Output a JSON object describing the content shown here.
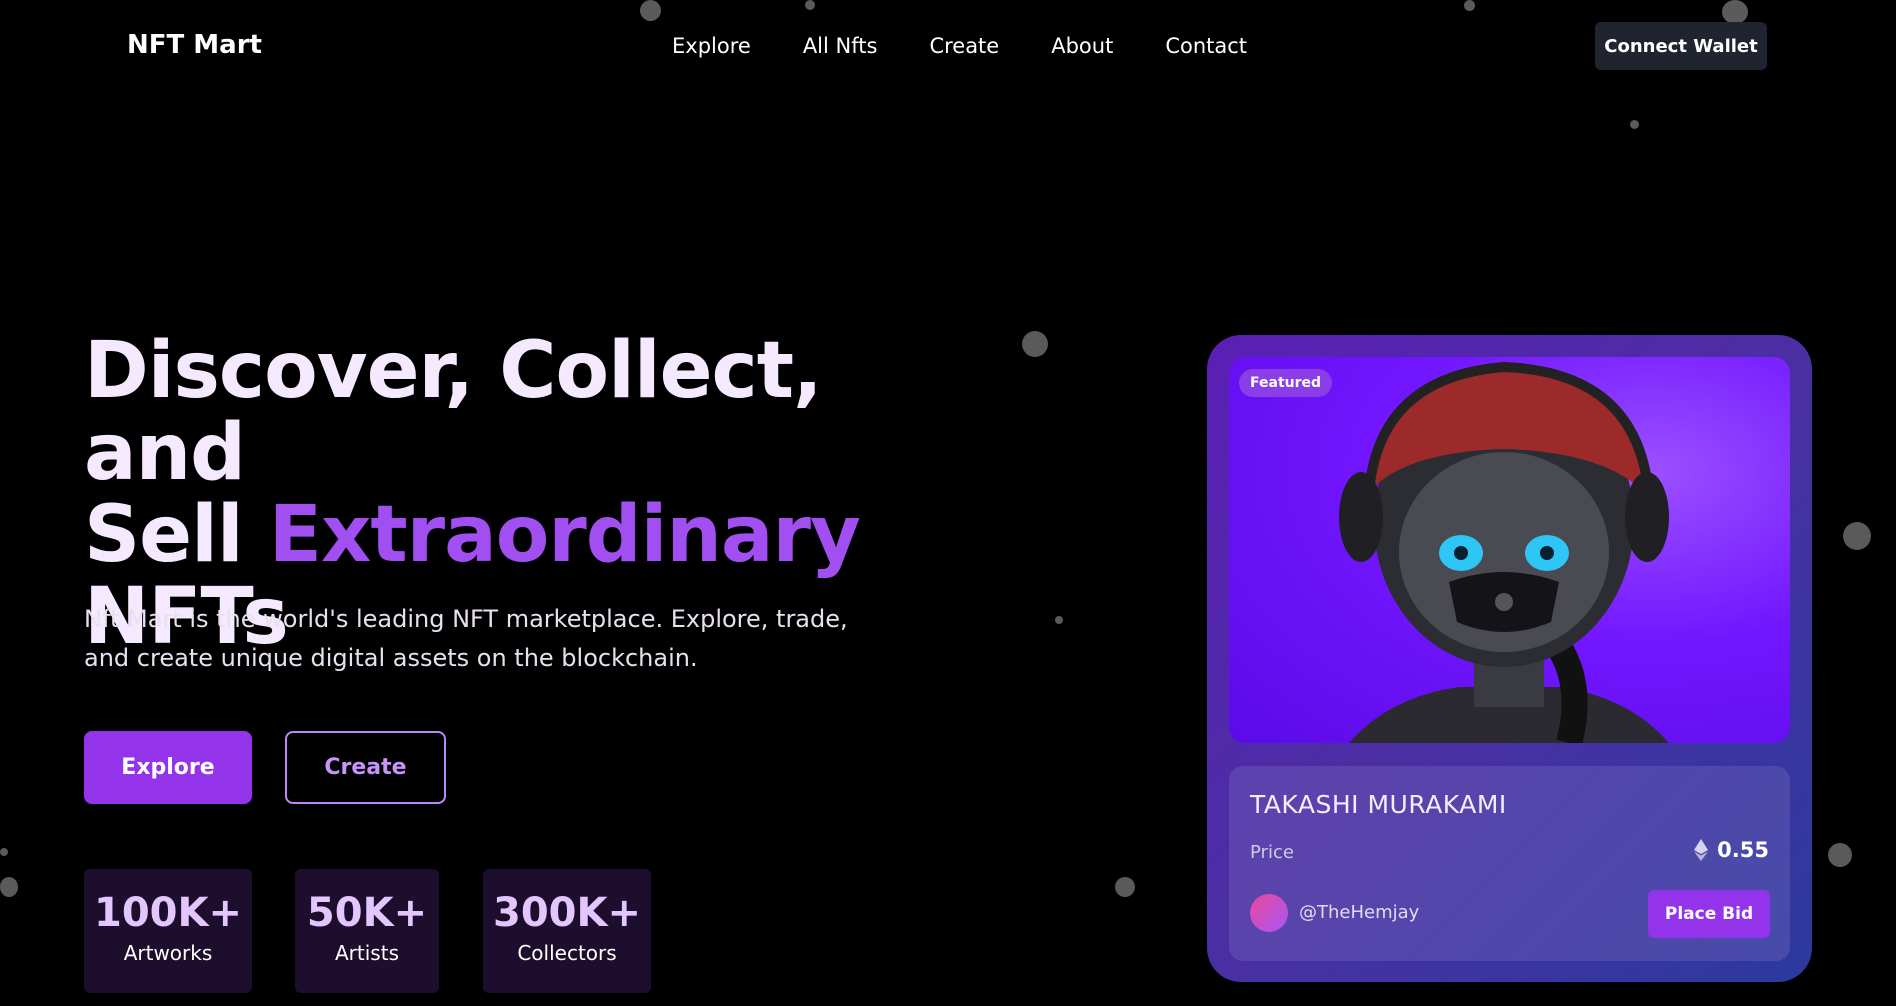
{
  "nav": {
    "logo": "NFT Mart",
    "links": [
      "Explore",
      "All Nfts",
      "Create",
      "About",
      "Contact"
    ],
    "connect_label": "Connect Wallet"
  },
  "hero": {
    "title_line1": "Discover, Collect, and",
    "title_sell": "Sell ",
    "title_accent": "Extraordinary",
    "title_line3": "NFTs",
    "description": "Nft Mart is the world's leading NFT marketplace. Explore, trade, and create unique digital assets on the blockchain.",
    "explore_label": "Explore",
    "create_label": "Create",
    "stats": [
      {
        "value": "100K+",
        "label": "Artworks"
      },
      {
        "value": "50K+",
        "label": "Artists"
      },
      {
        "value": "300K+",
        "label": "Collectors"
      }
    ]
  },
  "card": {
    "badge": "Featured",
    "title": "TAKASHI MURAKAMI",
    "price_label": "Price",
    "price_value": "0.55",
    "currency_icon": "ethereum-icon",
    "handle": "@TheHemjay",
    "bid_label": "Place Bid"
  },
  "colors": {
    "accent": "#9333ea",
    "accent_text": "#a24ff2",
    "background": "#000000"
  }
}
